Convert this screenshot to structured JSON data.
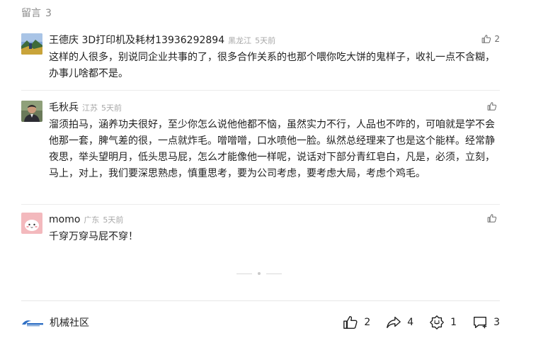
{
  "section": {
    "title": "留言",
    "count": "3"
  },
  "comments": [
    {
      "author": "王德庆 3D打印机及耗材13936292894",
      "region": "黑龙江",
      "time": "5天前",
      "likes": "2",
      "avatar_icon": "landscape-avatar",
      "text": "这样的人很多，别说同企业共事的了，很多合作关系的也那个喂你吃大饼的鬼样子，收礼一点不含糊，办事儿啥都不是。"
    },
    {
      "author": "毛秋兵",
      "region": "江苏",
      "time": "5天前",
      "likes": "",
      "avatar_icon": "person-photo-avatar",
      "text": "溜须拍马，涵养功夫很好，至少你怎么说他他都不恼，虽然实力不行，人品也不咋的，可咱就是学不会他那一套，脾气差的很，一点就炸毛。噌噌噌，口水喷他一脸。纵然总经理来了也是这个能样。经常静夜思，举头望明月，低头思马屁，怎么才能像他一样呢，说话对下部分青红皂白，凡是，必须，立刻，马上，对上，我们要深思熟虑，慎重思考，要为公司考虑，要考虑大局，考虑个鸡毛。"
    },
    {
      "author": "momo",
      "region": "广东",
      "time": "5天前",
      "likes": "",
      "avatar_icon": "cartoon-pink-avatar",
      "text": "千穿万穿马屁不穿！"
    }
  ],
  "footer": {
    "source_name": "机械社区",
    "source_icon": "brand-logo",
    "actions": [
      {
        "icon": "thumbs-up-icon",
        "count": "2"
      },
      {
        "icon": "share-icon",
        "count": "4"
      },
      {
        "icon": "favorite-icon",
        "count": "1"
      },
      {
        "icon": "comment-icon",
        "count": "3"
      }
    ]
  },
  "colors": {
    "text": "#1f1f1f",
    "muted": "#8a8a8a",
    "divider": "#ececec"
  }
}
